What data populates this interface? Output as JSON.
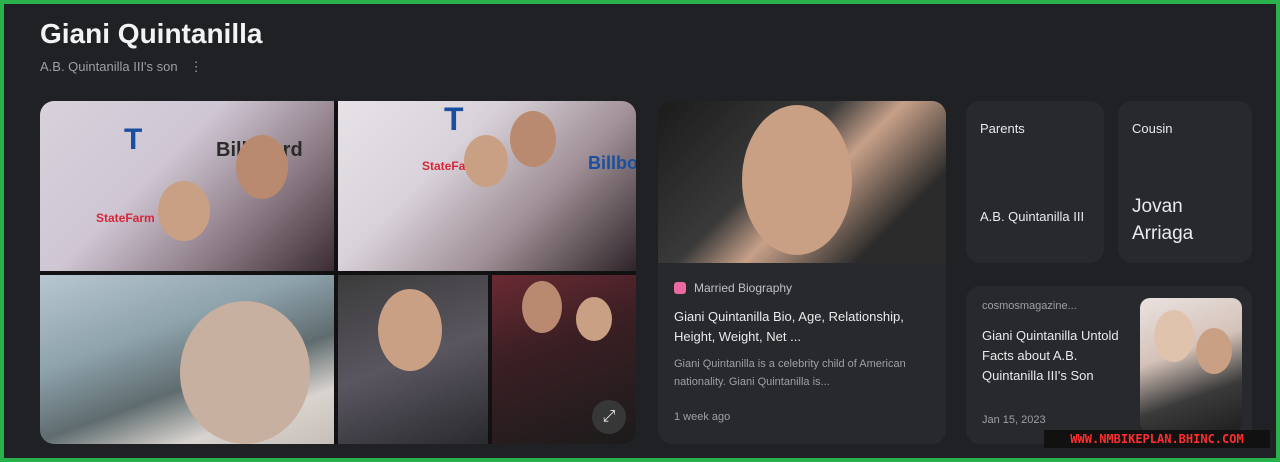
{
  "entity": {
    "title": "Giani Quintanilla",
    "subtitle": "A.B. Quintanilla III's son",
    "subtitle_menu": "⋮"
  },
  "photo_grid": {
    "logo_t": "T",
    "logo_billboard": "Billboard",
    "logo_statefarm": "StateFarm",
    "expand_icon": "⤢"
  },
  "result_card": {
    "source": "Married Biography",
    "title": "Giani Quintanilla Bio, Age, Relationship, Height, Weight, Net ...",
    "snippet": "Giani Quintanilla is a celebrity child of American nationality. Giani Quintanilla is...",
    "date": "1 week ago"
  },
  "related": [
    {
      "label": "Parents",
      "value": "A.B. Quintanilla III"
    },
    {
      "label": "Cousin",
      "value": "Jovan Arriaga"
    }
  ],
  "article_card": {
    "source": "cosmosmagazine...",
    "title": "Giani Quintanilla Untold Facts about A.B. Quintanilla III's Son",
    "date": "Jan 15, 2023"
  },
  "watermark": "WWW.NMBIKEPLAN.BHINC.COM",
  "colors": {
    "border": "#2bb14c",
    "background": "#202124",
    "card": "#28292c",
    "favicon": "#e86aa0"
  }
}
